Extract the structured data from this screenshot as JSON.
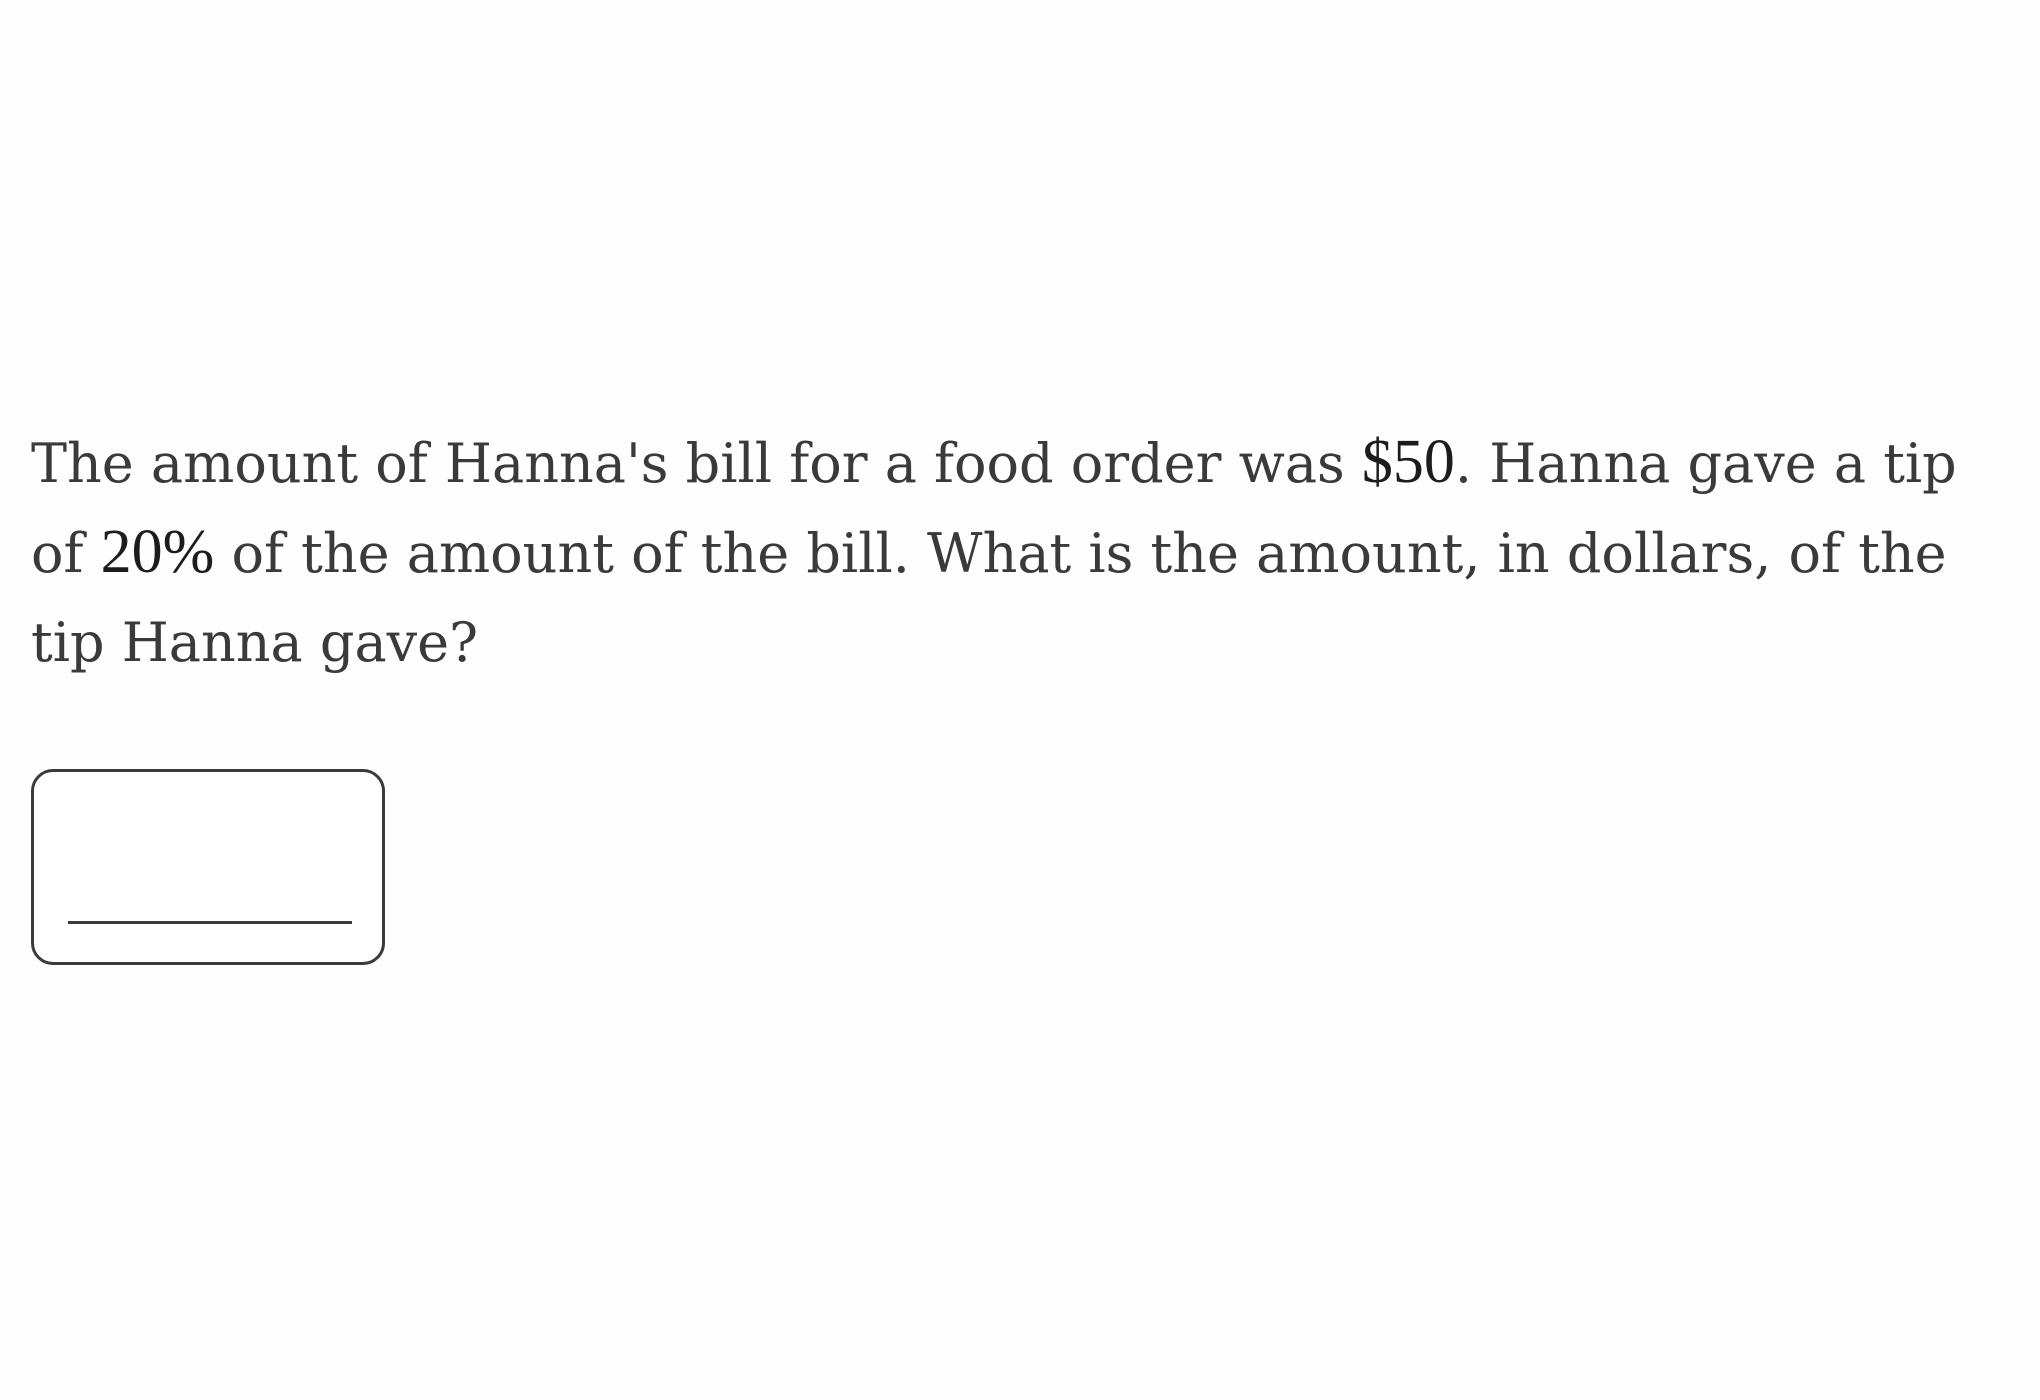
{
  "question": {
    "text_1": "The amount of Hanna's bill for a food order was ",
    "bill_amount": "$50",
    "text_2": ". Hanna gave a tip of ",
    "tip_percent": "20%",
    "text_3": " of the amount of the bill. What is the amount, in dollars, of the tip Hanna gave?"
  },
  "answer": {
    "value": "",
    "placeholder": ""
  }
}
